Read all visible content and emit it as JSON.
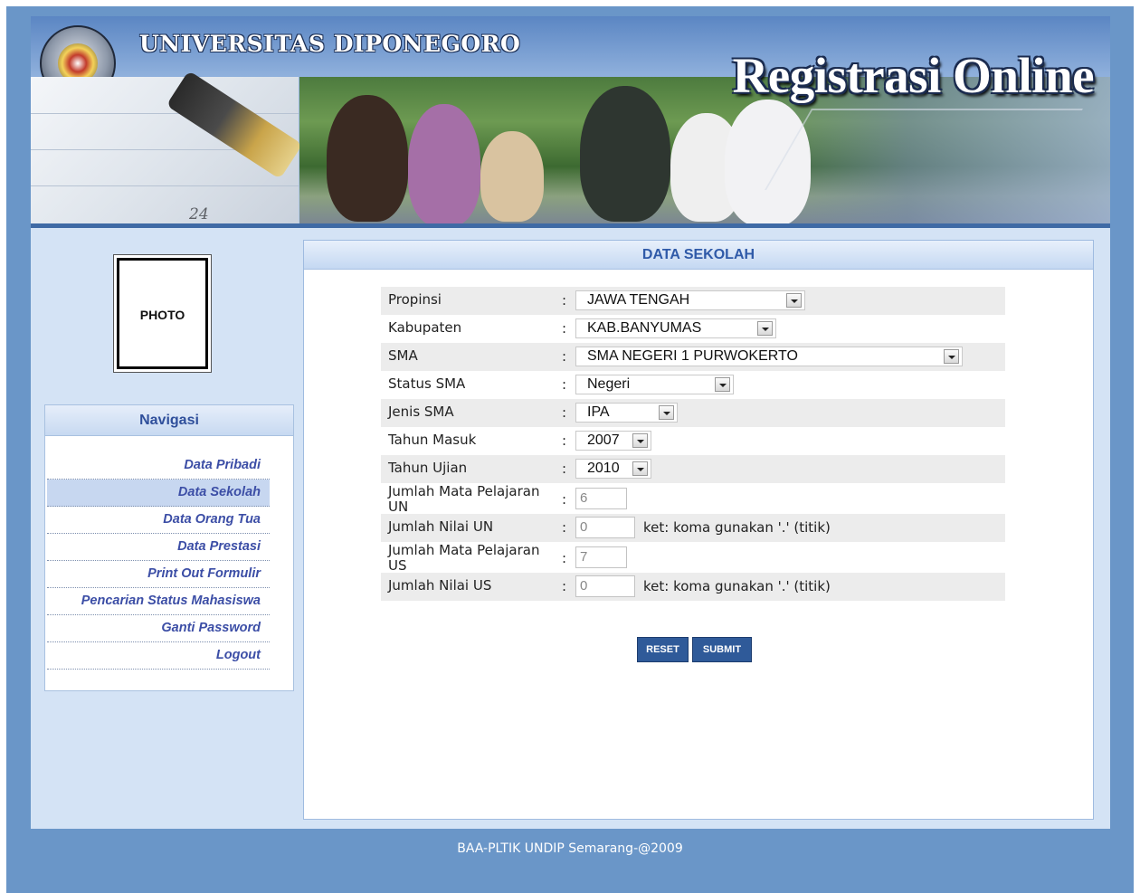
{
  "header": {
    "university": "UNIVERSITAS DIPONEGORO",
    "title": "Registrasi Online",
    "logo_text": "UNIVERSITAS DIPONEGORO SEMARANG",
    "pen_number": "24"
  },
  "photo": {
    "label": "PHOTO"
  },
  "navigation": {
    "title": "Navigasi",
    "items": [
      {
        "label": "Data Pribadi",
        "active": false
      },
      {
        "label": "Data Sekolah",
        "active": true
      },
      {
        "label": "Data Orang Tua",
        "active": false
      },
      {
        "label": "Data Prestasi",
        "active": false
      },
      {
        "label": "Print Out Formulir",
        "active": false
      },
      {
        "label": "Pencarian Status Mahasiswa",
        "active": false
      },
      {
        "label": "Ganti Password",
        "active": false
      },
      {
        "label": "Logout",
        "active": false
      }
    ]
  },
  "main": {
    "title": "DATA SEKOLAH",
    "fields": {
      "propinsi": {
        "label": "Propinsi",
        "value": "JAWA TENGAH"
      },
      "kabupaten": {
        "label": "Kabupaten",
        "value": "KAB.BANYUMAS"
      },
      "sma": {
        "label": "SMA",
        "value": "SMA NEGERI 1 PURWOKERTO"
      },
      "status_sma": {
        "label": "Status SMA",
        "value": "Negeri"
      },
      "jenis_sma": {
        "label": "Jenis SMA",
        "value": "IPA"
      },
      "tahun_masuk": {
        "label": "Tahun Masuk",
        "value": "2007"
      },
      "tahun_ujian": {
        "label": "Tahun Ujian",
        "value": "2010"
      },
      "jumlah_mapel_un": {
        "label": "Jumlah Mata Pelajaran UN",
        "value": "6"
      },
      "jumlah_nilai_un": {
        "label": "Jumlah Nilai UN",
        "value": "0",
        "note": "ket: koma gunakan '.' (titik)"
      },
      "jumlah_mapel_us": {
        "label": "Jumlah Mata Pelajaran US",
        "value": "7"
      },
      "jumlah_nilai_us": {
        "label": "Jumlah Nilai US",
        "value": "0",
        "note": "ket: koma gunakan '.' (titik)"
      }
    },
    "colon": ":",
    "buttons": {
      "reset": "RESET",
      "submit": "SUBMIT"
    }
  },
  "footer": {
    "text": "BAA-PLTIK UNDIP Semarang-@2009"
  },
  "colors": {
    "outer_background": "#6a96c8",
    "page_background": "#d4e3f5",
    "nav_link": "#3c4ea6",
    "heading": "#2f5aa8",
    "button": "#2f5a99"
  }
}
